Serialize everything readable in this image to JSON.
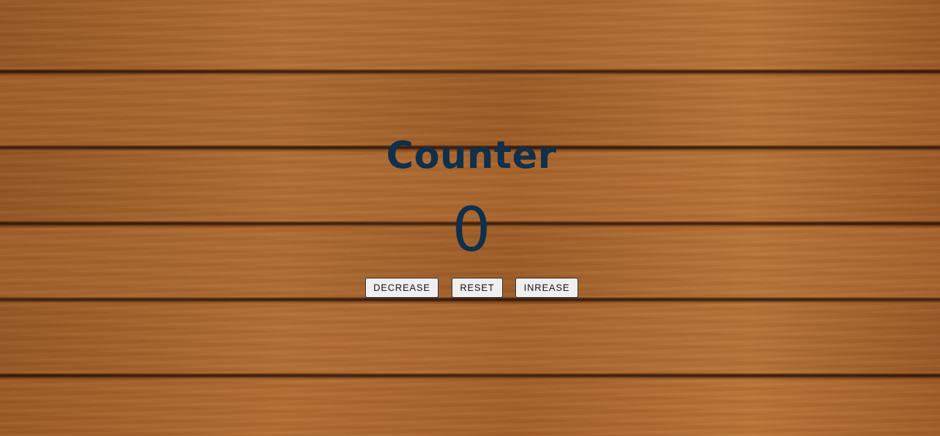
{
  "counter": {
    "title": "Counter",
    "value": "0"
  },
  "buttons": {
    "decrease_label": "DECREASE",
    "reset_label": "RESET",
    "increase_label": "INREASE"
  },
  "colors": {
    "text": "#10304b",
    "wood": "#a4612b",
    "button_bg": "#efefef"
  }
}
